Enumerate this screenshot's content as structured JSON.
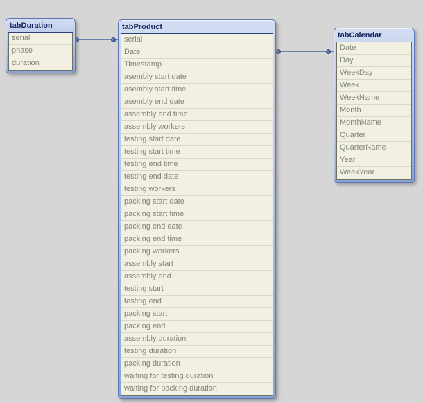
{
  "diagram": {
    "background": "#d6d6d6",
    "tables": [
      {
        "title": "tabDuration",
        "fields": [
          "serial",
          "phase",
          "duration"
        ]
      },
      {
        "title": "tabProduct",
        "fields": [
          "serial",
          "Date",
          "Timestamp",
          "asembly start date",
          "asembly start time",
          "asembly end date",
          "assembly end time",
          "assembly workers",
          "testing start date",
          "testing start time",
          "testing end time",
          "testing end date",
          "testing workers",
          "packing start date",
          "packing start time",
          "packing end date",
          "packing end time",
          "packing workers",
          "assembly start",
          "assembly end",
          "testing start",
          "testing end",
          "packing start",
          "packing end",
          "assembly duration",
          "testing duration",
          "packing duration",
          "waiting for testing duration",
          "waiting for packing duration"
        ]
      },
      {
        "title": "tabCalendar",
        "fields": [
          "Date",
          "Day",
          "WeekDay",
          "Week",
          "WeekName",
          "Month",
          "MonthName",
          "Quarter",
          "QuarterName",
          "Year",
          "WeekYear"
        ]
      }
    ],
    "connections": [
      {
        "from_table": "tabDuration",
        "from_field": "serial",
        "to_table": "tabProduct",
        "to_field": "serial"
      },
      {
        "from_table": "tabProduct",
        "from_field": "Date",
        "to_table": "tabCalendar",
        "to_field": "Date"
      }
    ],
    "colors": {
      "header_gradient_top": "#d2ddf2",
      "header_gradient_bottom": "#8ba2d3",
      "window_border": "#5c77b5",
      "title_text": "#17265e",
      "body_background": "#f1f0e2",
      "body_border": "#6a7265",
      "row_separator": "#d8d7c8",
      "field_text": "#85857c",
      "connector_line": "#6d80ab",
      "connector_dot": "#3c5390"
    }
  }
}
